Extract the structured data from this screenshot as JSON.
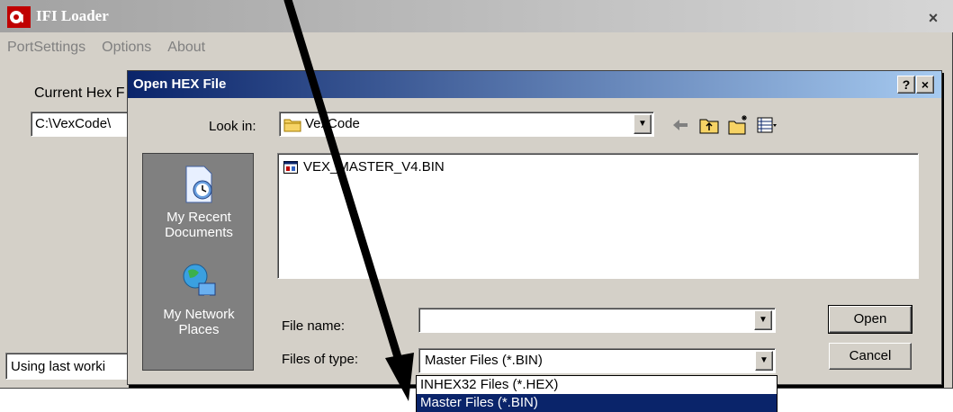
{
  "main_window": {
    "title": "IFI Loader",
    "close_glyph": "×",
    "menu": [
      "PortSettings",
      "Options",
      "About"
    ],
    "current_hex_label": "Current Hex F",
    "current_hex_value": "C:\\VexCode\\",
    "status_text": "Using last worki"
  },
  "dialog": {
    "title": "Open HEX File",
    "help_glyph": "?",
    "close_glyph": "×",
    "look_in_label": "Look in:",
    "look_in_value": "VexCode",
    "places": [
      {
        "label": "My Recent Documents",
        "icon": "recent-documents-icon"
      },
      {
        "label": "My Network Places",
        "icon": "network-places-icon"
      }
    ],
    "files": [
      {
        "name": "VEX_MASTER_V4.BIN",
        "icon": "bin-file-icon"
      }
    ],
    "file_name_label": "File name:",
    "file_name_value": "",
    "files_of_type_label": "Files of type:",
    "files_of_type_value": "Master Files (*.BIN)",
    "open_button": "Open",
    "cancel_button": "Cancel",
    "type_options": [
      "INHEX32 Files (*.HEX)",
      "Master Files (*.BIN)"
    ],
    "selected_type_index": 1
  },
  "colors": {
    "dialog_title_start": "#0a246a",
    "dialog_title_end": "#a6caf0",
    "selection": "#0a246a",
    "face": "#d4d0c8"
  }
}
